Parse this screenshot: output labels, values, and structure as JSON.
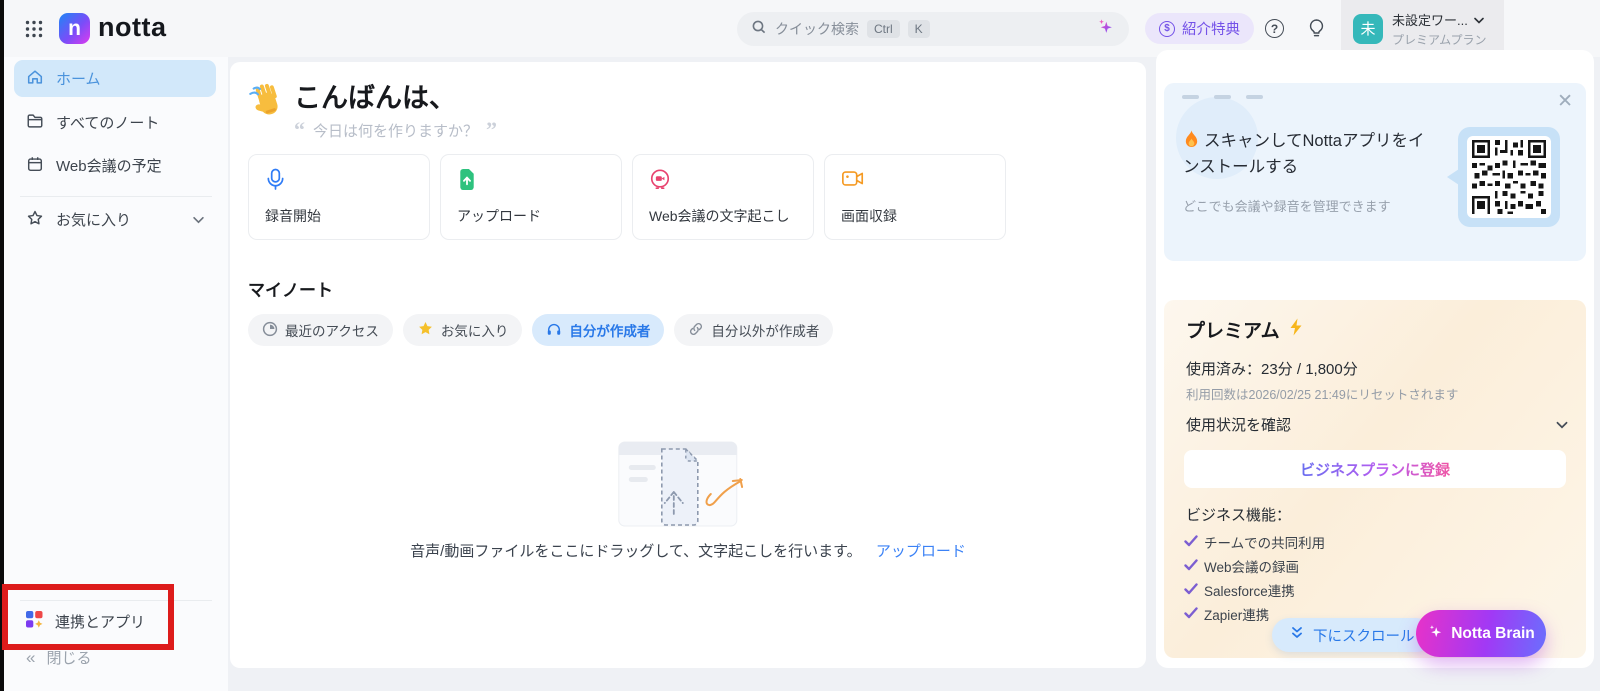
{
  "app": {
    "name": "notta",
    "logo_letter": "n"
  },
  "header": {
    "search": {
      "placeholder": "クイック検索",
      "keys": [
        "Ctrl",
        "K"
      ]
    },
    "referral_label": "紹介特典",
    "workspace": {
      "avatar_initial": "未",
      "name": "未設定ワー...",
      "plan": "プレミアムプラン"
    }
  },
  "sidebar": {
    "items": [
      {
        "label": "ホーム",
        "icon": "home-icon",
        "active": true
      },
      {
        "label": "すべてのノート",
        "icon": "folder-icon",
        "active": false
      },
      {
        "label": "Web会議の予定",
        "icon": "calendar-icon",
        "active": false
      },
      {
        "label": "お気に入り",
        "icon": "star-icon",
        "active": false
      }
    ],
    "integrations_label": "連携とアプリ",
    "collapse_label": "閉じる"
  },
  "main": {
    "greeting": "こんばんは、",
    "quote": "今日は何を作りますか？",
    "actions": [
      {
        "label": "録音開始",
        "icon": "microphone-icon",
        "color": "#2f7cf6"
      },
      {
        "label": "アップロード",
        "icon": "file-upload-icon",
        "color": "#2ec27e"
      },
      {
        "label": "Web会議の文字起こし",
        "icon": "meeting-bot-icon",
        "color": "#e8436f"
      },
      {
        "label": "画面収録",
        "icon": "screen-record-icon",
        "color": "#f59a23"
      }
    ],
    "my_notes": {
      "title": "マイノート",
      "filters": [
        {
          "label": "最近のアクセス",
          "icon": "clock-icon",
          "active": false
        },
        {
          "label": "お気に入り",
          "icon": "star-filled-icon",
          "active": false
        },
        {
          "label": "自分が作成者",
          "icon": "headphones-icon",
          "active": true
        },
        {
          "label": "自分以外が作成者",
          "icon": "link-icon",
          "active": false
        }
      ],
      "empty_text": "音声/動画ファイルをここにドラッグして、文字起こしを行います。",
      "upload_link": "アップロード"
    }
  },
  "right_panel": {
    "qr_card": {
      "title": "スキャンしてNottaアプリをインストールする",
      "subtitle": "どこでも会議や録音を管理できます"
    },
    "premium": {
      "title": "プレミアム",
      "usage_label": "使用済み：23分 / 1,800分",
      "reset_note": "利用回数は2026/02/25 21:49にリセットされます",
      "usage_status_label": "使用状況を確認",
      "upgrade_button": "ビジネスプランに登録",
      "features_title": "ビジネス機能：",
      "features": [
        "チームでの共同利用",
        "Web会議の録画",
        "Salesforce連携",
        "Zapier連携"
      ]
    },
    "scroll_button": "下にスクロール",
    "brain_button": "Notta Brain"
  },
  "colors": {
    "accent_blue": "#2878e8",
    "brand_gradient_start": "#2e7cf6",
    "brand_gradient_end": "#d33df0",
    "annotation_red": "#dd1b1b",
    "premium_bg": "#fbeeda",
    "avatar_teal": "#35b8ba"
  }
}
